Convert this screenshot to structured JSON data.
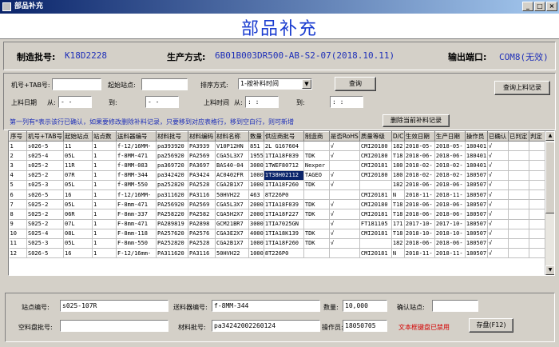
{
  "window": {
    "title": "部品补充",
    "min": "_",
    "max": "□",
    "close": "×"
  },
  "header": {
    "title": "部品补充"
  },
  "info": {
    "batch_label": "制造批号:",
    "batch_value": "K18D2228",
    "method_label": "生产方式:",
    "method_value": "6B01B003DR500-AB-S2-07(2018.10.11)",
    "port_label": "输出端口:",
    "port_value": "COM8(无效)"
  },
  "filters": {
    "machine_label": "机号+TAB号:",
    "start_station_label": "起始站点:",
    "sort_label": "排序方式:",
    "sort_value": "1-按补料时间",
    "query_button": "查询",
    "query_records_button": "查询上料记录",
    "date_label": "上料日期",
    "from_label": "从:",
    "to_label": "到:",
    "date_from": "  -  -",
    "date_to": "  -  -",
    "time_label": "上料时间",
    "time_from_label": "从:",
    "time_to_label": "到:",
    "time_from": "  :  :",
    "time_to": "  :  :",
    "delete_button": "删除当前补料记录"
  },
  "notice": "第一列有*表示该行已确认，如果要修改删除补料记录，只要移到对应表格行，移到空白行，则可新增",
  "table": {
    "columns": [
      "序号",
      "机号+TAB号",
      "起始站点",
      "站点数",
      "送料器编号",
      "材料批号",
      "材料编码",
      "材料名称",
      "数量",
      "供应商批号",
      "制造商",
      "是否RoHS",
      "质量等级",
      "D/C",
      "生效日期",
      "生产日期",
      "操作员",
      "已确认",
      "已判定",
      "判定"
    ],
    "rows": [
      [
        "1",
        "s026-5",
        "11",
        "1",
        "f-12/16MM-",
        "pa393920",
        "PA3939",
        "V10P12HN",
        "851",
        "2L G167604",
        "",
        "√",
        "CMI20180",
        "182",
        "2018-05-",
        "2018-05-",
        "180401",
        "√",
        "",
        ""
      ],
      [
        "2",
        "s025-4",
        "05L",
        "1",
        "f-8MM-471",
        "pa256920",
        "PA2569",
        "CGA5L3X7",
        "1955",
        "1TIA18F039",
        "TDK",
        "√",
        "CMI20180",
        "T18",
        "2018-06-",
        "2018-06-",
        "180401",
        "√",
        "",
        ""
      ],
      [
        "3",
        "s025-2",
        "11R",
        "1",
        "f-8MM-083",
        "pa369720",
        "PA3697",
        "BAS40-04",
        "3000",
        "1TWEF80712",
        "Nexper",
        "",
        "CMI20181",
        "180",
        "2018-02-",
        "2018-02-",
        "180401",
        "√",
        "",
        ""
      ],
      [
        "4",
        "s025-2",
        "07R",
        "1",
        "f-8MM-344",
        "pa342420",
        "PA3424",
        "AC0402FR",
        "1000",
        "1T38H02112",
        "TAGEO",
        "√",
        "CMI20180",
        "180",
        "2018-02-",
        "2018-02-",
        "180507",
        "√",
        "",
        ""
      ],
      [
        "5",
        "s025-3",
        "05L",
        "1",
        "f-8MM-550",
        "pa252820",
        "PA2528",
        "CGA2B1X7",
        "1000",
        "1TIA18F260",
        "TDK",
        "√",
        "",
        "182",
        "2018-06-",
        "2018-06-",
        "180507",
        "√",
        "",
        ""
      ],
      [
        "6",
        "s026-5",
        "16",
        "1",
        "f-12/16MM-",
        "pa311620",
        "PA3116",
        "50HVH22",
        "463",
        "8T226P0",
        "",
        "",
        "CMI20181",
        "N",
        "2018-11-",
        "2018-11-",
        "180507",
        "√",
        "",
        ""
      ],
      [
        "7",
        "S025-2",
        "05L",
        "1",
        "F-8mm-471",
        "PA256920",
        "PA2569",
        "CGA5L3X7",
        "2000",
        "1TIA18F039",
        "TDK",
        "√",
        "CMI20180",
        "T18",
        "2018-06-",
        "2018-06-",
        "180507",
        "√",
        "",
        ""
      ],
      [
        "8",
        "S025-2",
        "06R",
        "1",
        "F-8mm-337",
        "PA258220",
        "PA2582",
        "CGA5H2X7",
        "2000",
        "1TIA18F227",
        "TDK",
        "√",
        "CMI20181",
        "T18",
        "2018-06-",
        "2018-06-",
        "180507",
        "√",
        "",
        ""
      ],
      [
        "9",
        "S025-2",
        "07L",
        "1",
        "F-8mm-471",
        "PA289819",
        "PA2898",
        "GCM21BR7",
        "3000",
        "1TIA7025GN",
        "",
        "√",
        "FT181105",
        "171",
        "2017-10-",
        "2017-10-",
        "180507",
        "√",
        "",
        ""
      ],
      [
        "10",
        "S025-4",
        "08L",
        "1",
        "F-8mm-118",
        "PA257620",
        "PA2576",
        "CGA3E2X7",
        "4000",
        "1TIA18K139",
        "TDK",
        "√",
        "CMI20181",
        "T18",
        "2018-10-",
        "2018-10-",
        "180507",
        "√",
        "",
        ""
      ],
      [
        "11",
        "S025-3",
        "05L",
        "1",
        "F-8mm-550",
        "PA252820",
        "PA2528",
        "CGA2B1X7",
        "1000",
        "1TIA18F260",
        "TDK",
        "√",
        "",
        "182",
        "2018-06-",
        "2018-06-",
        "180507",
        "√",
        "",
        ""
      ],
      [
        "12",
        "S026-5",
        "16",
        "1",
        "F-12/16mm-",
        "PA311620",
        "PA3116",
        "50HVH22",
        "1000",
        "8T226P0",
        "",
        "",
        "CMI20181",
        "N",
        "2018-11-",
        "2018-11-",
        "180507",
        "√",
        "",
        ""
      ]
    ],
    "highlight": {
      "row": 3,
      "col": 9
    }
  },
  "bottom": {
    "station_label": "站点编号:",
    "station_value": "s025-107R",
    "feeder_label": "送料器编号:",
    "feeder_value": "f-8MM-344",
    "qty_label": "数量:",
    "qty_value": "10,000",
    "confirm_label": "确认站点:",
    "empty_reel_label": "空料盘批号:",
    "material_label": "材料批号:",
    "material_value": "pa34242002260124",
    "operator_label": "操作员:",
    "operator_value": "18050705",
    "disabled_text": "文本框键盘已禁用",
    "save_button": "存盘(F12)"
  }
}
